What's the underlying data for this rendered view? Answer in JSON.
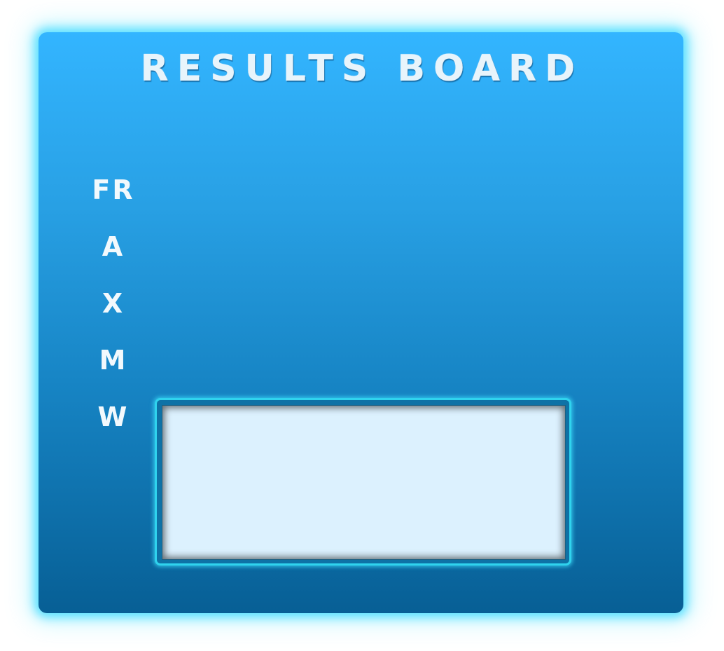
{
  "board": {
    "title": "RESULTS BOARD",
    "rows": [
      {
        "label": "FR"
      },
      {
        "label": "A"
      },
      {
        "label": "X"
      },
      {
        "label": "M"
      },
      {
        "label": "W"
      }
    ],
    "result_box_value": ""
  },
  "colors": {
    "board_top": "#33b5ff",
    "board_bottom": "#075f95",
    "glow": "#46dcff",
    "frame_border": "#2fd3ee",
    "result_fill": "#dcf1fe",
    "text": "#f2f9fd"
  }
}
